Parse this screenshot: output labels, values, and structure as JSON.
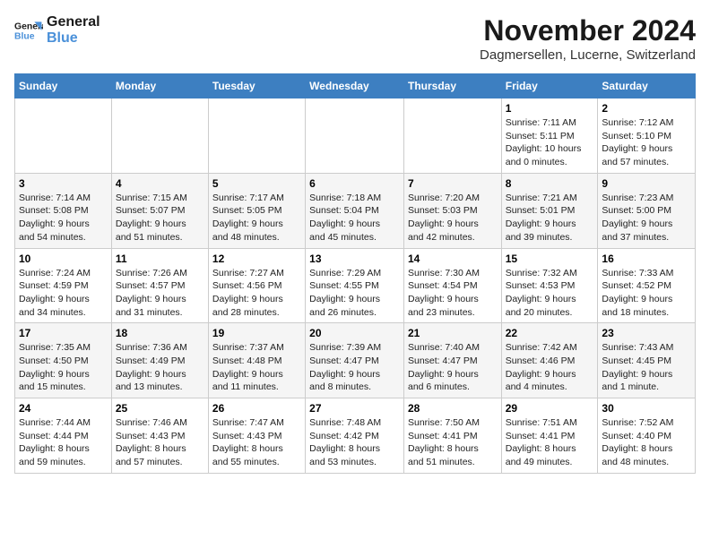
{
  "logo": {
    "line1": "General",
    "line2": "Blue"
  },
  "title": "November 2024",
  "location": "Dagmersellen, Lucerne, Switzerland",
  "days_of_week": [
    "Sunday",
    "Monday",
    "Tuesday",
    "Wednesday",
    "Thursday",
    "Friday",
    "Saturday"
  ],
  "weeks": [
    [
      {
        "day": "",
        "info": ""
      },
      {
        "day": "",
        "info": ""
      },
      {
        "day": "",
        "info": ""
      },
      {
        "day": "",
        "info": ""
      },
      {
        "day": "",
        "info": ""
      },
      {
        "day": "1",
        "info": "Sunrise: 7:11 AM\nSunset: 5:11 PM\nDaylight: 10 hours\nand 0 minutes."
      },
      {
        "day": "2",
        "info": "Sunrise: 7:12 AM\nSunset: 5:10 PM\nDaylight: 9 hours\nand 57 minutes."
      }
    ],
    [
      {
        "day": "3",
        "info": "Sunrise: 7:14 AM\nSunset: 5:08 PM\nDaylight: 9 hours\nand 54 minutes."
      },
      {
        "day": "4",
        "info": "Sunrise: 7:15 AM\nSunset: 5:07 PM\nDaylight: 9 hours\nand 51 minutes."
      },
      {
        "day": "5",
        "info": "Sunrise: 7:17 AM\nSunset: 5:05 PM\nDaylight: 9 hours\nand 48 minutes."
      },
      {
        "day": "6",
        "info": "Sunrise: 7:18 AM\nSunset: 5:04 PM\nDaylight: 9 hours\nand 45 minutes."
      },
      {
        "day": "7",
        "info": "Sunrise: 7:20 AM\nSunset: 5:03 PM\nDaylight: 9 hours\nand 42 minutes."
      },
      {
        "day": "8",
        "info": "Sunrise: 7:21 AM\nSunset: 5:01 PM\nDaylight: 9 hours\nand 39 minutes."
      },
      {
        "day": "9",
        "info": "Sunrise: 7:23 AM\nSunset: 5:00 PM\nDaylight: 9 hours\nand 37 minutes."
      }
    ],
    [
      {
        "day": "10",
        "info": "Sunrise: 7:24 AM\nSunset: 4:59 PM\nDaylight: 9 hours\nand 34 minutes."
      },
      {
        "day": "11",
        "info": "Sunrise: 7:26 AM\nSunset: 4:57 PM\nDaylight: 9 hours\nand 31 minutes."
      },
      {
        "day": "12",
        "info": "Sunrise: 7:27 AM\nSunset: 4:56 PM\nDaylight: 9 hours\nand 28 minutes."
      },
      {
        "day": "13",
        "info": "Sunrise: 7:29 AM\nSunset: 4:55 PM\nDaylight: 9 hours\nand 26 minutes."
      },
      {
        "day": "14",
        "info": "Sunrise: 7:30 AM\nSunset: 4:54 PM\nDaylight: 9 hours\nand 23 minutes."
      },
      {
        "day": "15",
        "info": "Sunrise: 7:32 AM\nSunset: 4:53 PM\nDaylight: 9 hours\nand 20 minutes."
      },
      {
        "day": "16",
        "info": "Sunrise: 7:33 AM\nSunset: 4:52 PM\nDaylight: 9 hours\nand 18 minutes."
      }
    ],
    [
      {
        "day": "17",
        "info": "Sunrise: 7:35 AM\nSunset: 4:50 PM\nDaylight: 9 hours\nand 15 minutes."
      },
      {
        "day": "18",
        "info": "Sunrise: 7:36 AM\nSunset: 4:49 PM\nDaylight: 9 hours\nand 13 minutes."
      },
      {
        "day": "19",
        "info": "Sunrise: 7:37 AM\nSunset: 4:48 PM\nDaylight: 9 hours\nand 11 minutes."
      },
      {
        "day": "20",
        "info": "Sunrise: 7:39 AM\nSunset: 4:47 PM\nDaylight: 9 hours\nand 8 minutes."
      },
      {
        "day": "21",
        "info": "Sunrise: 7:40 AM\nSunset: 4:47 PM\nDaylight: 9 hours\nand 6 minutes."
      },
      {
        "day": "22",
        "info": "Sunrise: 7:42 AM\nSunset: 4:46 PM\nDaylight: 9 hours\nand 4 minutes."
      },
      {
        "day": "23",
        "info": "Sunrise: 7:43 AM\nSunset: 4:45 PM\nDaylight: 9 hours\nand 1 minute."
      }
    ],
    [
      {
        "day": "24",
        "info": "Sunrise: 7:44 AM\nSunset: 4:44 PM\nDaylight: 8 hours\nand 59 minutes."
      },
      {
        "day": "25",
        "info": "Sunrise: 7:46 AM\nSunset: 4:43 PM\nDaylight: 8 hours\nand 57 minutes."
      },
      {
        "day": "26",
        "info": "Sunrise: 7:47 AM\nSunset: 4:43 PM\nDaylight: 8 hours\nand 55 minutes."
      },
      {
        "day": "27",
        "info": "Sunrise: 7:48 AM\nSunset: 4:42 PM\nDaylight: 8 hours\nand 53 minutes."
      },
      {
        "day": "28",
        "info": "Sunrise: 7:50 AM\nSunset: 4:41 PM\nDaylight: 8 hours\nand 51 minutes."
      },
      {
        "day": "29",
        "info": "Sunrise: 7:51 AM\nSunset: 4:41 PM\nDaylight: 8 hours\nand 49 minutes."
      },
      {
        "day": "30",
        "info": "Sunrise: 7:52 AM\nSunset: 4:40 PM\nDaylight: 8 hours\nand 48 minutes."
      }
    ]
  ]
}
